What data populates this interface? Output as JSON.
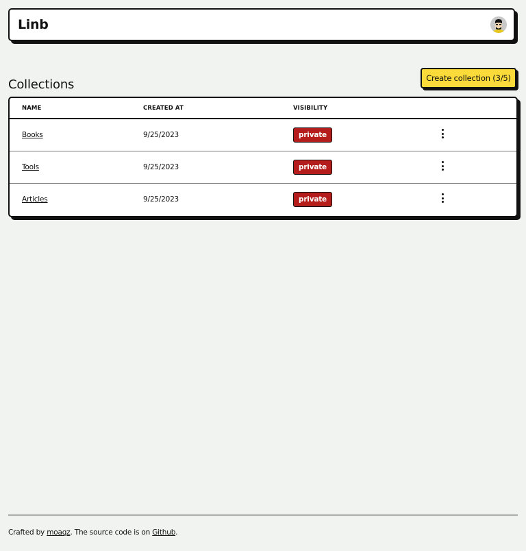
{
  "header": {
    "brand": "Linb",
    "avatar_icon": "user-avatar"
  },
  "main": {
    "title": "Collections",
    "create_button": "Create collection (3/5)",
    "table": {
      "columns": [
        "NAME",
        "CREATED AT",
        "VISIBILITY",
        ""
      ],
      "rows": [
        {
          "name": "Books",
          "created_at": "9/25/2023",
          "visibility": "private"
        },
        {
          "name": "Tools",
          "created_at": "9/25/2023",
          "visibility": "private"
        },
        {
          "name": "Articles",
          "created_at": "9/25/2023",
          "visibility": "private"
        }
      ]
    }
  },
  "footer": {
    "prefix": "Crafted by ",
    "author": "moaqz",
    "middle": ". The source code is on ",
    "repo": "Github",
    "suffix": "."
  },
  "colors": {
    "accent": "#fadb3a",
    "badge": "#b51c1c",
    "background": "#f1f3f0"
  }
}
